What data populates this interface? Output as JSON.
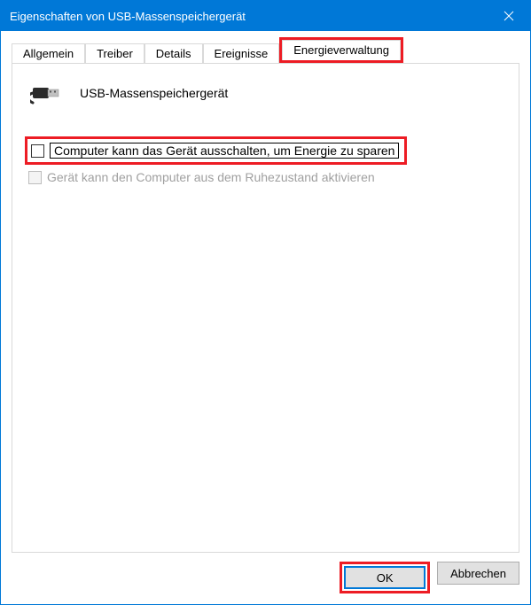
{
  "window": {
    "title": "Eigenschaften von USB-Massenspeichergerät"
  },
  "tabs": {
    "general": "Allgemein",
    "driver": "Treiber",
    "details": "Details",
    "events": "Ereignisse",
    "power": "Energieverwaltung"
  },
  "device": {
    "name": "USB-Massenspeichergerät"
  },
  "options": {
    "allow_off": "Computer kann das Gerät ausschalten, um Energie zu sparen",
    "allow_wake": "Gerät kann den Computer aus dem Ruhezustand aktivieren"
  },
  "buttons": {
    "ok": "OK",
    "cancel": "Abbrechen"
  },
  "highlight_color": "#ed1c24"
}
